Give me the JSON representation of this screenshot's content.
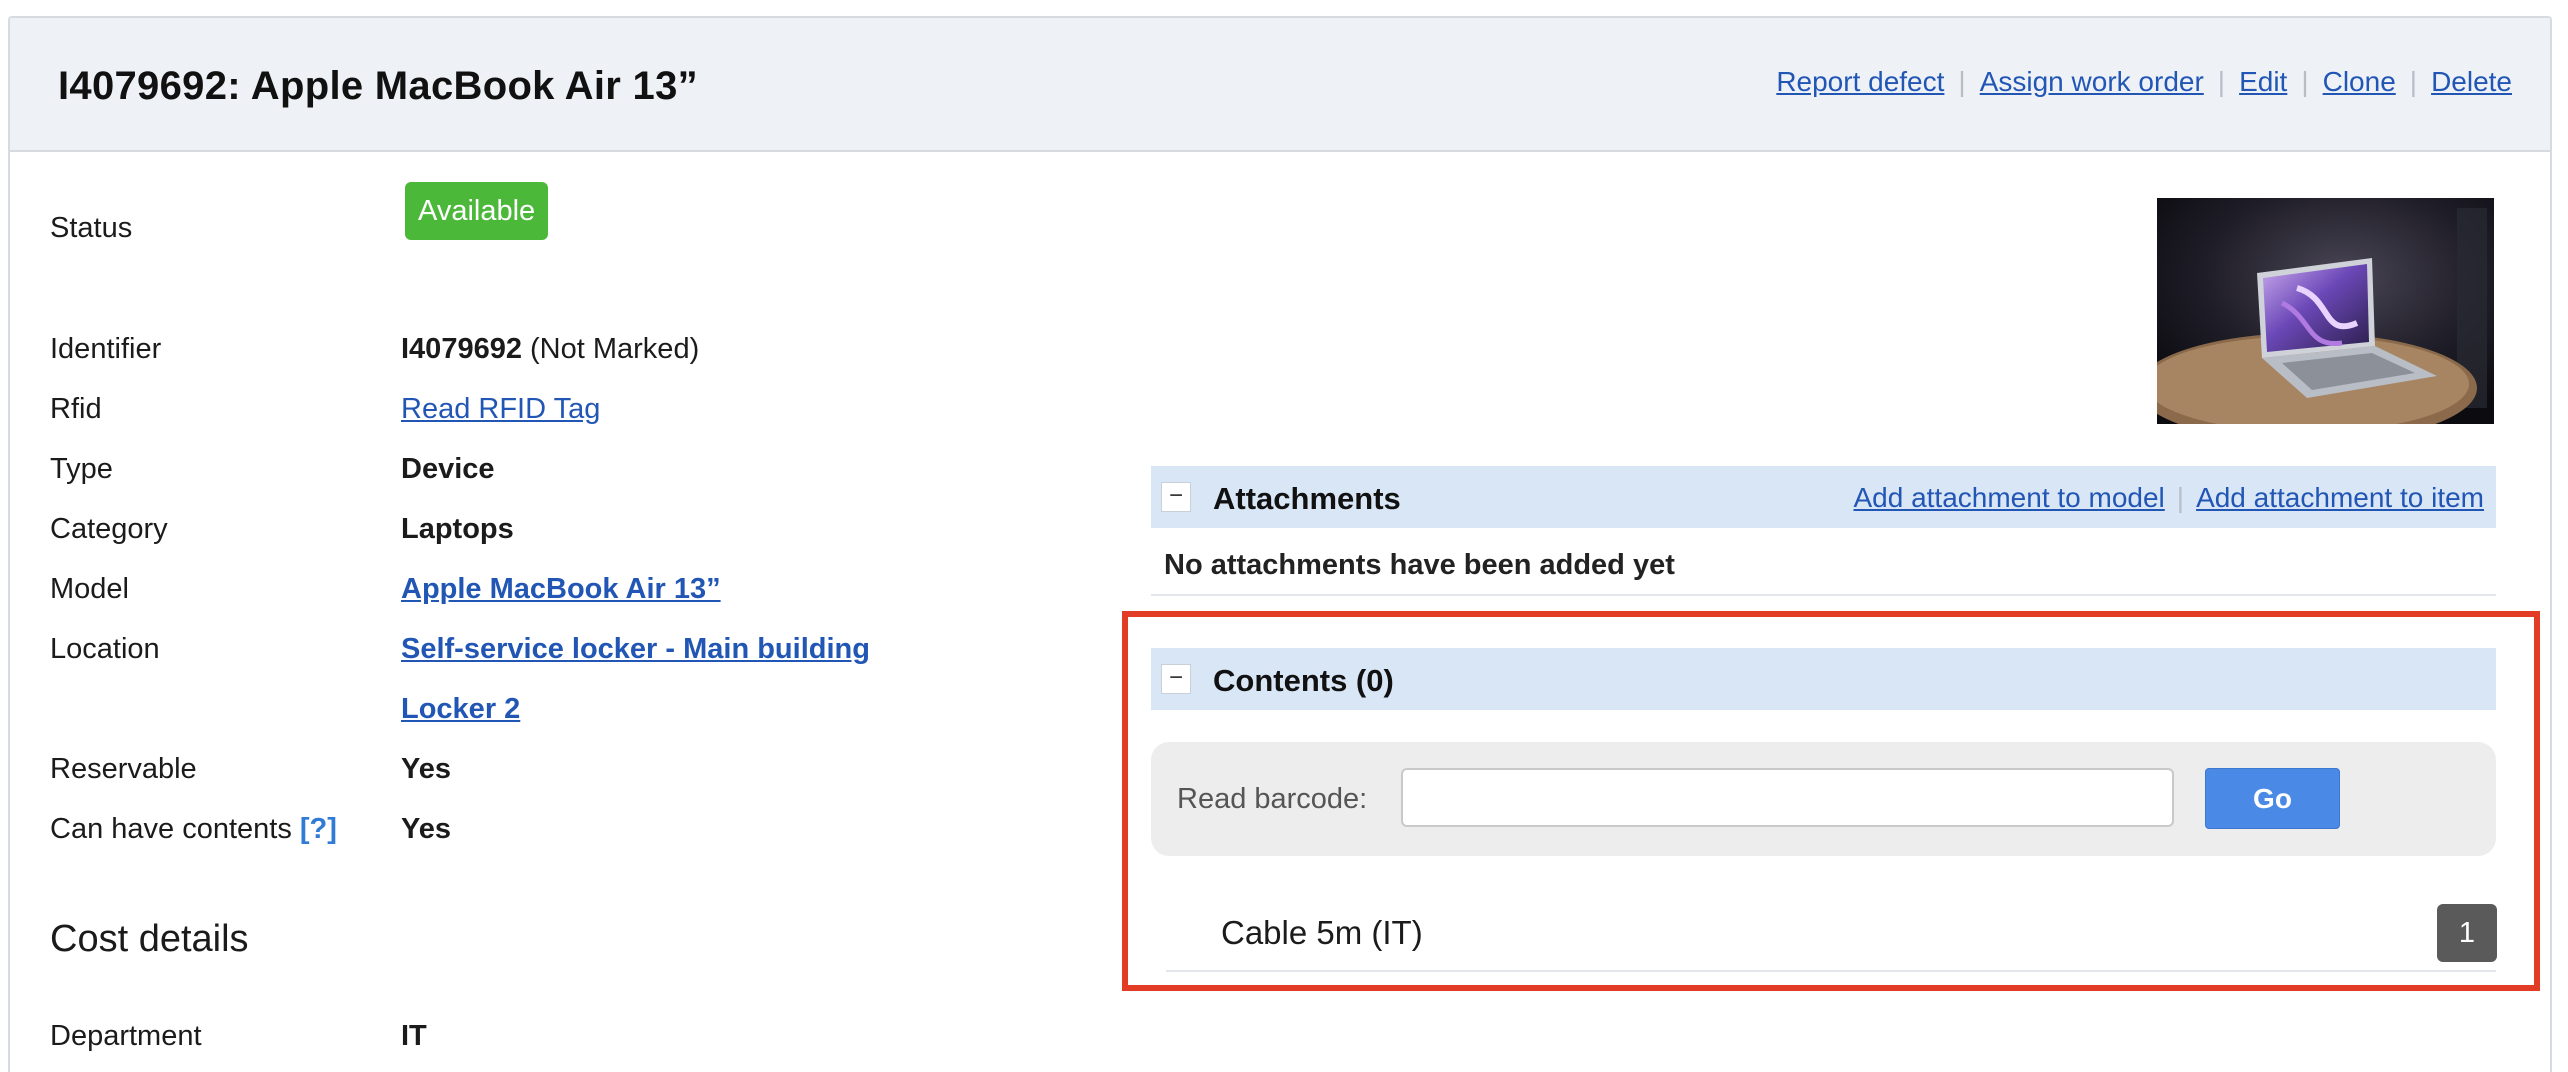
{
  "header": {
    "title": "I4079692: Apple MacBook Air 13”",
    "actions": [
      "Report defect",
      "Assign work order",
      "Edit",
      "Clone",
      "Delete"
    ]
  },
  "details": {
    "status_label": "Status",
    "status_value": "Available",
    "identifier_label": "Identifier",
    "identifier_value": "I4079692",
    "identifier_note": " (Not Marked)",
    "rfid_label": "Rfid",
    "rfid_value": "Read RFID Tag",
    "type_label": "Type",
    "type_value": "Device",
    "category_label": "Category",
    "category_value": "Laptops",
    "model_label": "Model",
    "model_value": "Apple MacBook Air 13”",
    "location_label": "Location",
    "location_value": "Self-service locker - Main building",
    "location_sub": "Locker 2",
    "reservable_label": "Reservable",
    "reservable_value": "Yes",
    "contents_label": "Can have contents",
    "contents_help": "[?]",
    "contents_value": "Yes"
  },
  "cost": {
    "section_title": "Cost details",
    "department_label": "Department",
    "department_value": "IT"
  },
  "attachments": {
    "toggle": "−",
    "title": "Attachments",
    "link_model": "Add attachment to model",
    "link_item": "Add attachment to item",
    "empty_message": "No attachments have been added yet"
  },
  "contents": {
    "toggle": "−",
    "title": "Contents (0)",
    "barcode_label": "Read barcode:",
    "barcode_value": "",
    "go_label": "Go",
    "items": [
      {
        "name": "Cable 5m (IT)",
        "qty": "1"
      }
    ]
  },
  "colors": {
    "status_green": "#4cb83a",
    "link_blue": "#2256b5",
    "section_bar": "#d9e6f6",
    "go_blue": "#4a8ae6",
    "highlight_red": "#e23c26"
  },
  "icons": {
    "photo": "laptop-photo"
  }
}
